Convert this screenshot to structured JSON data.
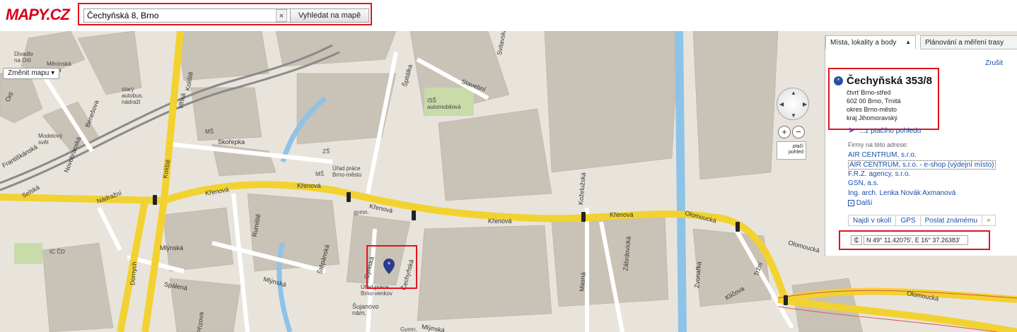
{
  "header": {
    "logo": "MAPY.CZ",
    "search_value": "Čechyňská 8, Brno",
    "clear_label": "×",
    "search_button": "Vyhledat na mapě"
  },
  "map": {
    "change_map_label": "Změnit mapu ▾",
    "labels": {
      "divadlo": "Divadlo\nna Orlí",
      "menin_brana": "Měnínská\nbrána",
      "stary_autobus": "starý\nautobus.\nnádraží",
      "ms1": "MŠ",
      "zs": "ZŠ",
      "ms2": "MŠ",
      "urad_prace": "Úřad práce\nBrno-město",
      "iss": "ISŠ\nautomobilová",
      "modelovy_svet": "Modelový\nsvět",
      "gymn": "gymn.",
      "ic_cd": "IC ČD",
      "urad_brno_venkov": "Úřad práce\nBrno-venkov",
      "sujanovo": "Šujanovo\nnám.",
      "gymn2": "Gymn."
    },
    "streets": {
      "krenova1": "Křenová",
      "krenova2": "Křenová",
      "krenova3": "Křenová",
      "krenova4": "Křenová",
      "krenova5": "Křenová",
      "skorepka": "Skořepka",
      "olomoucka1": "Olomoucká",
      "olomoucka2": "Olomoucká",
      "olomoucka3": "Olomoucká",
      "spalena": "Spálená",
      "mlynska1": "Mlýnská",
      "mlynska2": "Mlýnská",
      "mlynska3": "Mlýnská",
      "nadrazni": "Nádražní",
      "koliste1": "Koliště",
      "koliste2": "Koliště",
      "novobranska": "Novobranská",
      "benesova": "Benešova",
      "stavebni": "Stavební",
      "spitalka": "Špitálka",
      "cyrilska": "Cyrilská",
      "cechynska": "Čechyňská",
      "rumiste": "Rumiště",
      "dornych": "Dornych",
      "zvonarka": "Zvonařka",
      "trzni": "Tržní",
      "ktitova": "Klíčova",
      "masna": "Masná",
      "zabrdovicka": "Zábrdovická",
      "kozeluzska": "Koželužská",
      "svitavska": "Svitavská",
      "vlhka": "Vlhká",
      "stepanska": "Štěpánská",
      "frantiskanska": "Františkánská",
      "selska": "Selská",
      "orli": "Orlí",
      "prizova": "Přízova"
    },
    "bird_btn": "ptačí\npohled",
    "zoom_in": "+",
    "zoom_out": "−"
  },
  "panel": {
    "tab1": "Místa, lokality a body",
    "tab1_arrow": "▲",
    "tab2": "Plánování a měření trasy",
    "cancel": "Zrušit",
    "title": "Čechyňská 353/8",
    "lines": [
      "čtvrť Brno-střed",
      "602 00 Brno, Trnitá",
      "okres Brno-město",
      "kraj Jihomoravský"
    ],
    "bird_link": "...z ptačího pohledu",
    "firms_heading": "Firmy na této adrese:",
    "firms": [
      "AIR CENTRUM, s.r.o.",
      "AIR CENTRUM, s.r.o. - e-shop (výdejní místo)",
      "F.R.Z. agency, s.r.o.",
      "GSN, a.s.",
      "Ing. arch. Lenka Novák Axmanová"
    ],
    "more": "Další",
    "actions": [
      "Najdi v okolí",
      "GPS",
      "Poslat známému"
    ],
    "coords": "N 49° 11.42075', E 16° 37.26383'"
  }
}
